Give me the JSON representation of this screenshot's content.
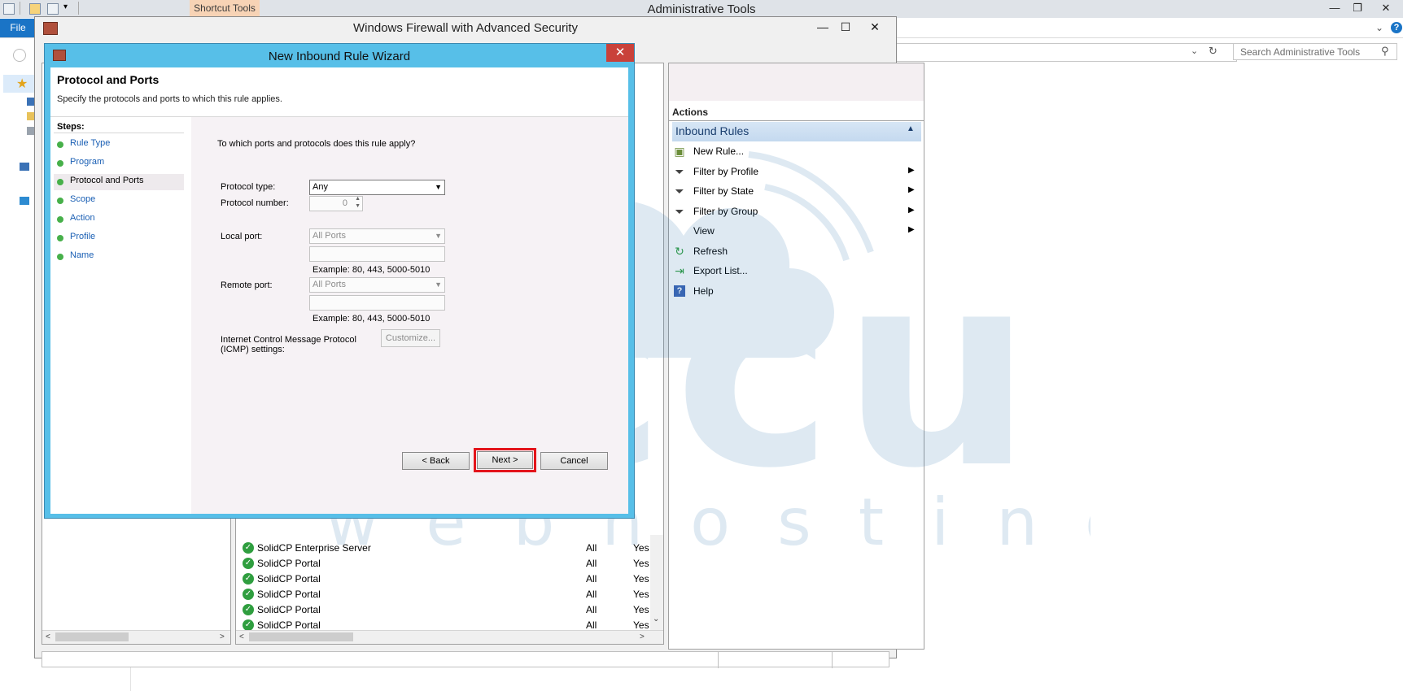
{
  "explorer": {
    "title": "Administrative Tools",
    "shortcut_tools_tab": "Shortcut Tools",
    "file_tab": "File",
    "search_placeholder": "Search Administrative Tools"
  },
  "mmc": {
    "title": "Windows Firewall with Advanced Security",
    "actions": {
      "header": "Actions",
      "section": "Inbound Rules",
      "items": [
        {
          "label": "New Rule...",
          "icon": "new-rule-icon",
          "submenu": false
        },
        {
          "label": "Filter by Profile",
          "icon": "filter-icon",
          "submenu": true
        },
        {
          "label": "Filter by State",
          "icon": "filter-icon",
          "submenu": true
        },
        {
          "label": "Filter by Group",
          "icon": "filter-icon",
          "submenu": true
        },
        {
          "label": "View",
          "icon": "",
          "submenu": true
        },
        {
          "label": "Refresh",
          "icon": "refresh-icon",
          "submenu": false
        },
        {
          "label": "Export List...",
          "icon": "export-icon",
          "submenu": false
        },
        {
          "label": "Help",
          "icon": "help-icon",
          "submenu": false
        }
      ]
    },
    "rules": [
      {
        "name": "SolidCP Enterprise Server",
        "profile": "All",
        "enabled": "Yes"
      },
      {
        "name": "SolidCP Portal",
        "profile": "All",
        "enabled": "Yes"
      },
      {
        "name": "SolidCP Portal",
        "profile": "All",
        "enabled": "Yes"
      },
      {
        "name": "SolidCP Portal",
        "profile": "All",
        "enabled": "Yes"
      },
      {
        "name": "SolidCP Portal",
        "profile": "All",
        "enabled": "Yes"
      },
      {
        "name": "SolidCP Portal",
        "profile": "All",
        "enabled": "Yes"
      }
    ]
  },
  "wizard": {
    "title": "New Inbound Rule Wizard",
    "heading": "Protocol and Ports",
    "subheading": "Specify the protocols and ports to which this rule applies.",
    "steps_label": "Steps:",
    "steps": [
      "Rule Type",
      "Program",
      "Protocol and Ports",
      "Scope",
      "Action",
      "Profile",
      "Name"
    ],
    "current_step": "Protocol and Ports",
    "question": "To which ports and protocols does this rule apply?",
    "protocol_type_label": "Protocol type:",
    "protocol_type_value": "Any",
    "protocol_number_label": "Protocol number:",
    "protocol_number_value": "0",
    "local_port_label": "Local port:",
    "local_port_value": "All Ports",
    "local_port_example": "Example: 80, 443, 5000-5010",
    "remote_port_label": "Remote port:",
    "remote_port_value": "All Ports",
    "remote_port_example": "Example: 80, 443, 5000-5010",
    "icmp_label_line1": "Internet Control Message Protocol",
    "icmp_label_line2": "(ICMP) settings:",
    "customize_label": "Customize...",
    "back_label": "< Back",
    "next_label": "Next >",
    "cancel_label": "Cancel"
  },
  "watermark": {
    "brand": "accu",
    "tagline": "webhosting"
  },
  "colors": {
    "wizard_frame": "#57bfe8",
    "highlight": "#e3141b",
    "file_tab": "#1a74c6",
    "step_dot": "#47b04a",
    "watermark": "#1d6aa8"
  }
}
